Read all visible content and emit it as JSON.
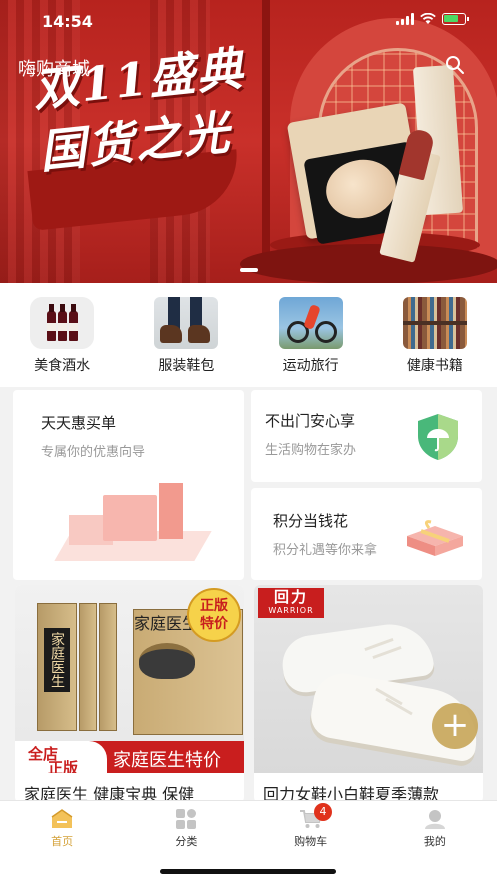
{
  "status_bar": {
    "time": "14:54"
  },
  "header": {
    "app_title": "嗨购商城"
  },
  "banner": {
    "slogan": "双11盛典\n国货之光"
  },
  "categories": [
    {
      "label": "美食酒水",
      "image": "wine-bottles"
    },
    {
      "label": "服装鞋包",
      "image": "leather-boots"
    },
    {
      "label": "运动旅行",
      "image": "cyclist"
    },
    {
      "label": "健康书籍",
      "image": "bookshelf"
    }
  ],
  "promos": {
    "deals": {
      "title": "天天惠买单",
      "subtitle": "专属你的优惠向导"
    },
    "home_service": {
      "title": "不出门安心享",
      "subtitle": "生活购物在家办"
    },
    "points": {
      "title": "积分当钱花",
      "subtitle": "积分礼遇等你来拿"
    }
  },
  "products": [
    {
      "name": "家庭医生 健康宝典 保健",
      "badge": [
        "正版",
        "特价"
      ],
      "spine_text": [
        "家庭医生",
        "家庭医生"
      ],
      "strip_tags": [
        "全店",
        "正版"
      ],
      "strip_text": "家庭医生特价"
    },
    {
      "name": "回力女鞋小白鞋夏季薄款",
      "brand_cn": "回力",
      "brand_en": "WARRIOR"
    }
  ],
  "tabbar": {
    "items": [
      {
        "label": "首页",
        "icon": "home-icon",
        "active": true
      },
      {
        "label": "分类",
        "icon": "grid-icon",
        "active": false
      },
      {
        "label": "购物车",
        "icon": "cart-icon",
        "active": false
      },
      {
        "label": "我的",
        "icon": "user-icon",
        "active": false
      }
    ],
    "cart_count": "4"
  },
  "colors": {
    "accent": "#d4a23a",
    "banner_red": "#c9302a",
    "badge_red": "#e0321c"
  }
}
